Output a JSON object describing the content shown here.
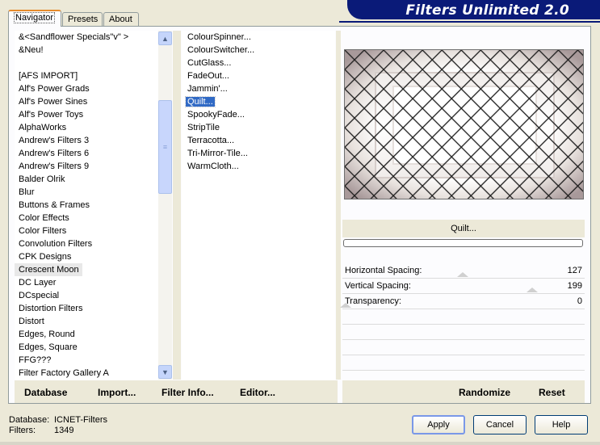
{
  "tabs": [
    {
      "label": "Navigator",
      "active": true
    },
    {
      "label": "Presets",
      "active": false
    },
    {
      "label": "About",
      "active": false
    }
  ],
  "banner": {
    "title": "Filters Unlimited 2.0",
    "color": "#0a1a78"
  },
  "categories": {
    "items": [
      "&<Sandflower Specials\"v\" >",
      "&Neu!",
      "",
      "[AFS IMPORT]",
      "Alf's Power Grads",
      "Alf's Power Sines",
      "Alf's Power Toys",
      "AlphaWorks",
      "Andrew's Filters 3",
      "Andrew's Filters 6",
      "Andrew's Filters 9",
      "Balder Olrik",
      "Blur",
      "Buttons & Frames",
      "Color Effects",
      "Color Filters",
      "Convolution Filters",
      "CPK Designs",
      "Crescent Moon",
      "DC Layer",
      "DCspecial",
      "Distortion Filters",
      "Distort",
      "Edges, Round",
      "Edges, Square",
      "FFG???",
      "Filter Factory Gallery A"
    ],
    "selected": "Crescent Moon"
  },
  "filters": {
    "items": [
      "ColourSpinner...",
      "ColourSwitcher...",
      "CutGlass...",
      "FadeOut...",
      "Jammin'...",
      "Quilt...",
      "SpookyFade...",
      "StripTile",
      "Terracotta...",
      "Tri-Mirror-Tile...",
      "WarmCloth..."
    ],
    "selected": "Quilt..."
  },
  "preview": {
    "filter_name": "Quilt...",
    "progress": 0
  },
  "params": [
    {
      "label": "Horizontal Spacing:",
      "value": "127"
    },
    {
      "label": "Vertical Spacing:",
      "value": "199"
    },
    {
      "label": "Transparency:",
      "value": "0"
    }
  ],
  "toolbar": {
    "database": "Database",
    "import": "Import...",
    "filter_info": "Filter Info...",
    "editor": "Editor...",
    "randomize": "Randomize",
    "reset": "Reset"
  },
  "status": {
    "database_label": "Database:",
    "database_value": "ICNET-Filters",
    "filters_label": "Filters:",
    "filters_value": "1349"
  },
  "buttons": {
    "apply": "Apply",
    "cancel": "Cancel",
    "help": "Help"
  },
  "colors": {
    "selection": "#316ac5",
    "accent_tab": "#e68b2c",
    "dialog_bg": "#ece9d8"
  }
}
